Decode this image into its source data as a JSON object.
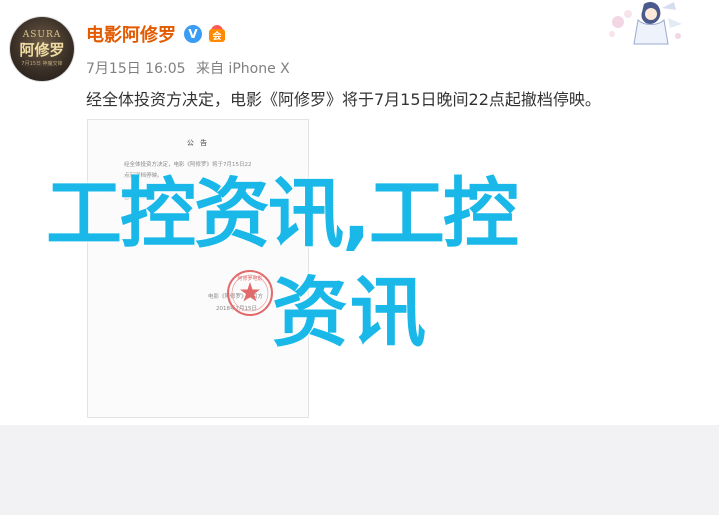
{
  "post": {
    "avatar": {
      "en": "ASURA",
      "cn": "阿修罗",
      "sub": "7月15日 神魔交锋"
    },
    "author": "电影阿修罗",
    "verified_mark": "V",
    "badge_char": "会",
    "time": "7月15日 16:05",
    "source": "来自 iPhone X",
    "text": "经全体投资方决定，电影《阿修罗》将于7月15日晚间22点起撤档停映。"
  },
  "document": {
    "title": "公 告",
    "lines": [
      "经全体投资方决定，电影《阿修罗》将于7月15日22",
      "点起撤档停映。",
      "",
      "感谢……"
    ],
    "sign_name": "电影《阿修罗》项目方",
    "sign_date": "2018年7月15日",
    "seal_text": "阿修罗电影"
  },
  "watermark": {
    "line1": "工控资讯,工控",
    "line2": "资讯"
  },
  "colors": {
    "author": "#e35b00",
    "verify": "#3a9cf5",
    "meta": "#808080",
    "watermark": "#19b8e9",
    "seal": "#e26a6a"
  }
}
